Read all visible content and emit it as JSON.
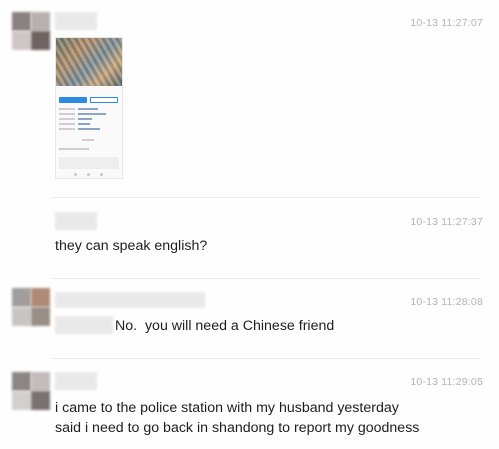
{
  "messages": [
    {
      "timestamp": "10-13 11:27:07",
      "type": "image",
      "image": {
        "icon": "phone-screenshot-thumbnail"
      }
    },
    {
      "timestamp": "10-13 11:27:37",
      "type": "text",
      "text": "they can speak english?"
    },
    {
      "timestamp": "10-13 11:28:08",
      "type": "text",
      "text": "No.  you will need a Chinese friend"
    },
    {
      "timestamp": "10-13 11:29:05",
      "type": "text",
      "lines": [
        "i came to the police station with my husband yesterday",
        "said i need to go back in shandong to report my goodness"
      ]
    }
  ],
  "colors": {
    "timestamp": "#b3b3b3",
    "text": "#1e1e1e",
    "divider": "#ececec"
  }
}
